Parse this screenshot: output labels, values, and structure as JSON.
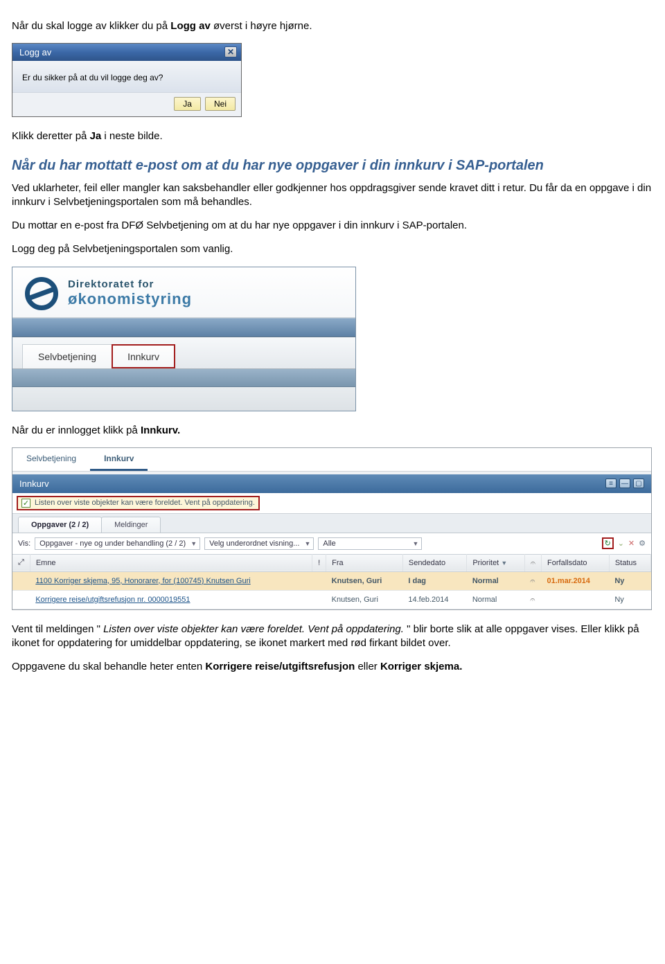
{
  "doc": {
    "p1_a": "Når du skal logge av klikker du på ",
    "p1_b": "Logg av",
    "p1_c": " øverst i høyre hjørne.",
    "p2_a": "Klikk deretter på ",
    "p2_b": "Ja",
    "p2_c": " i neste bilde.",
    "h2": "Når du har mottatt e-post om at du har nye oppgaver i din innkurv i SAP-portalen",
    "p3": "Ved uklarheter, feil eller mangler kan saksbehandler eller godkjenner hos oppdragsgiver sende kravet ditt i retur. Du får da en oppgave i din innkurv i Selvbetjeningsportalen som må behandles.",
    "p4": "Du mottar en e-post fra DFØ Selvbetjening om at du har nye oppgaver i din innkurv i SAP-portalen.",
    "p5": "Logg deg på Selvbetjeningsportalen som vanlig.",
    "p6_a": "Når du er innlogget klikk på ",
    "p6_b": "Innkurv.",
    "p7_a": "Vent til meldingen \"",
    "p7_b": "Listen over viste objekter kan være foreldet. Vent på oppdatering.",
    "p7_c": "\" blir borte slik at alle oppgaver vises. Eller klikk på ikonet for oppdatering for umiddelbar oppdatering, se ikonet markert med rød firkant bildet over.",
    "p8_a": "Oppgavene du skal behandle heter enten ",
    "p8_b": "Korrigere reise/utgiftsrefusjon",
    "p8_c": " eller ",
    "p8_d": "Korriger skjema."
  },
  "dialog": {
    "title": "Logg av",
    "body": "Er du sikker på at du vil logge deg av?",
    "btn_yes": "Ja",
    "btn_no": "Nei"
  },
  "portal": {
    "brand1": "Direktoratet for",
    "brand2": "økonomistyring",
    "tab1": "Selvbetjening",
    "tab2": "Innkurv"
  },
  "innkurv": {
    "top_tab1": "Selvbetjening",
    "top_tab2": "Innkurv",
    "panel_title": "Innkurv",
    "yellow_msg": "Listen over viste objekter kan være foreldet. Vent på oppdatering.",
    "inner_tab1": "Oppgaver  (2 / 2)",
    "inner_tab2": "Meldinger",
    "vis_label": "Vis:",
    "sel1": "Oppgaver - nye og under behandling  (2 / 2)",
    "sel2": "Velg underordnet visning...",
    "sel3": "Alle",
    "col_emne": "Emne",
    "col_bang": "!",
    "col_fra": "Fra",
    "col_sendt": "Sendedato",
    "col_pri": "Prioritet",
    "col_forfall": "Forfallsdato",
    "col_status": "Status",
    "row1_emne": "1100 Korriger skjema, 95, Honorarer, for (100745) Knutsen Guri",
    "row1_fra": "Knutsen, Guri",
    "row1_sendt": "I dag",
    "row1_pri": "Normal",
    "row1_forfall": "01.mar.2014",
    "row1_status": "Ny",
    "row2_emne": "Korrigere reise/utgiftsrefusjon nr. 0000019551",
    "row2_fra": "Knutsen, Guri",
    "row2_sendt": "14.feb.2014",
    "row2_pri": "Normal",
    "row2_status": "Ny"
  }
}
